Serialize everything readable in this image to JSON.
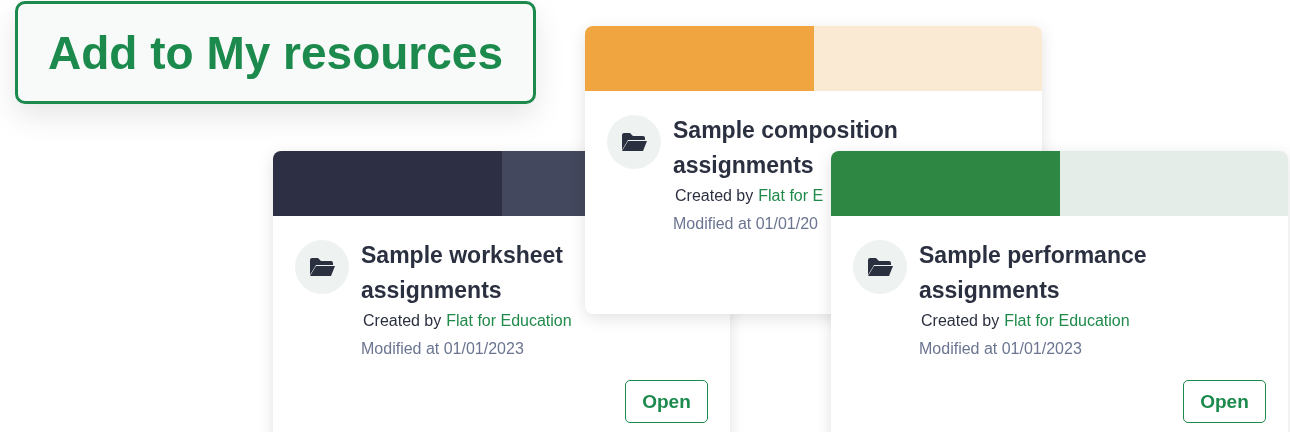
{
  "add_button": {
    "label": "Add to My resources"
  },
  "cards": [
    {
      "kind": "composition",
      "title": "Sample composition assignments",
      "created_prefix": "Created by",
      "author": "Flat for E",
      "modified": "Modified at 01/01/20"
    },
    {
      "kind": "worksheet",
      "title": "Sample worksheet assignments",
      "created_prefix": "Created by",
      "author": "Flat for Education",
      "modified": "Modified at 01/01/2023",
      "open_button": "Open"
    },
    {
      "kind": "performance",
      "title": "Sample performance assignments",
      "created_prefix": "Created by",
      "author": "Flat for Education",
      "modified": "Modified at 01/01/2023",
      "open_button": "Open"
    }
  ]
}
